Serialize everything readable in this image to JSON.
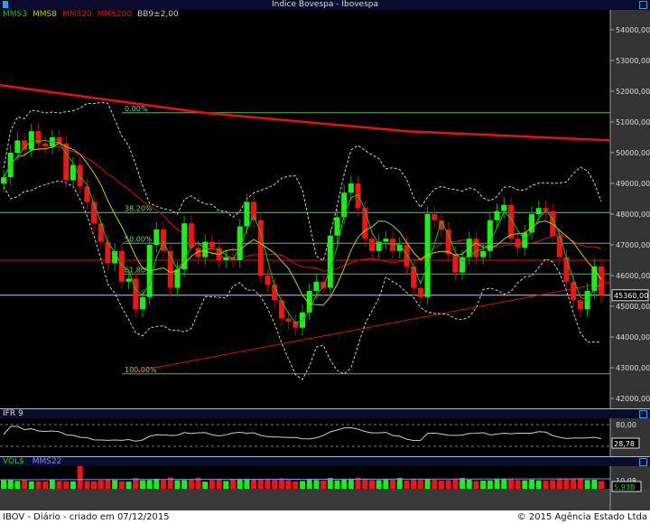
{
  "window": {
    "title": "Indice Bovespa - Ibovespa"
  },
  "legend": [
    {
      "label": "MMS3",
      "color": "#17c217"
    },
    {
      "label": "MMS8",
      "color": "#c8c800"
    },
    {
      "label": "MMS20",
      "color": "#e01010"
    },
    {
      "label": "MMS200",
      "color": "#e01010"
    },
    {
      "label": "BB9±2,00",
      "color": "#cccccc"
    }
  ],
  "price_axis": {
    "ticks": [
      "54000,00",
      "53000,00",
      "52000,00",
      "51000,00",
      "50000,00",
      "49000,00",
      "48000,00",
      "47000,00",
      "46000,00",
      "45000,00",
      "44000,00",
      "43000,00",
      "42000,00"
    ],
    "range": [
      42000,
      54000
    ],
    "last_value": "45360,00",
    "last": 45360
  },
  "fibonacci": [
    {
      "label": "0.00%",
      "price": 51300
    },
    {
      "label": "38.20%",
      "price": 48050
    },
    {
      "label": "50.00%",
      "price": 47050
    },
    {
      "label": "61.80%",
      "price": 46050
    },
    {
      "label": "100.00%",
      "price": 42800
    }
  ],
  "support_line": {
    "price": 46500,
    "color": "#e01010"
  },
  "trend_line": {
    "from": 42850,
    "to": 45800
  },
  "mms200": [
    52200,
    51300,
    50700,
    50400
  ],
  "closes": [
    49200,
    50000,
    50400,
    50100,
    50700,
    50300,
    50200,
    50500,
    50300,
    49100,
    49600,
    48900,
    48400,
    47700,
    47100,
    46400,
    46800,
    45800,
    45900,
    44900,
    45300,
    47000,
    47500,
    46800,
    45600,
    46200,
    47700,
    46900,
    46600,
    47100,
    46900,
    46500,
    46600,
    46500,
    47600,
    48400,
    47800,
    46000,
    45700,
    45200,
    44600,
    44500,
    44300,
    44800,
    45500,
    45800,
    45600,
    47300,
    47900,
    48700,
    49000,
    48200,
    47200,
    46800,
    47100,
    47200,
    46800,
    47000,
    46300,
    45600,
    45300,
    48000,
    47800,
    47500,
    46700,
    46100,
    46600,
    47200,
    46600,
    46800,
    47800,
    48100,
    48300,
    47200,
    46900,
    47400,
    48000,
    48200,
    48100,
    47300,
    46600,
    45800,
    45200,
    44900,
    45500,
    46300,
    45360
  ],
  "ifr": {
    "title": "IFR 9",
    "ticks": [
      "80,00"
    ],
    "last_value": "28,78"
  },
  "volume": {
    "title": "VOL$",
    "ma_label": "MMS22",
    "ma_color": "#8888ff",
    "tick": "10,08",
    "last_value": "5,93B",
    "values": [
      6.4,
      6.2,
      5.9,
      6.2,
      5.8,
      5.8,
      5.8,
      6.3,
      5.9,
      5.8,
      5.8,
      13,
      5.9,
      5.8,
      6.1,
      6.3,
      6.2,
      5.8,
      5.7,
      6.8,
      6.1,
      6.2,
      6.6,
      6.2,
      7.0,
      6.1,
      6.2,
      6.3,
      6.9,
      5.7,
      6.2,
      6.6,
      5.9,
      6.5,
      6.4,
      6.6,
      6.5,
      6.3,
      6.4,
      6.5,
      6.7,
      6.2,
      5.8,
      5.9,
      6.5,
      6.2,
      6.0,
      6.8,
      6.1,
      6.3,
      6.4,
      6.9,
      6.6,
      6.2,
      6.2,
      6.4,
      6.3,
      6.8,
      6.1,
      6.4,
      6.5,
      6.4,
      6.3,
      6.0,
      6.2,
      6.6,
      6.8,
      6.3,
      5.9,
      6.0,
      6.1,
      6.4,
      6.6,
      6.4,
      6.2,
      6.1,
      6.3,
      6.1,
      6.0,
      6.2,
      6.5,
      6.4,
      6.6,
      6.7,
      6.2,
      6.3,
      5.93
    ]
  },
  "footer": {
    "left": "IBOV - Diário - criado em 07/12/2015",
    "right": "© 2015 Agência Estado Ltda"
  },
  "colors": {
    "up": "#19f019",
    "down": "#f01414",
    "axis_bg": "#333333",
    "header_bg": "#0b0b2e"
  }
}
